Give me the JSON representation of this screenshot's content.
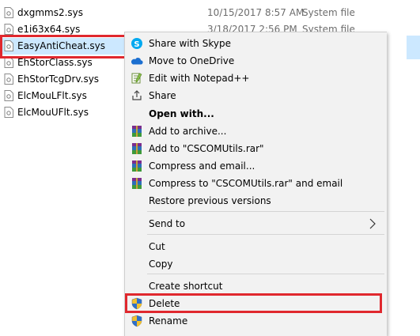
{
  "files": [
    {
      "name": "dxgmms2.sys",
      "date": "10/15/2017 8:57 AM",
      "type": "System file"
    },
    {
      "name": "e1i63x64.sys",
      "date": "3/18/2017 2:56 PM",
      "type": "System file"
    },
    {
      "name": "EasyAntiCheat.sys",
      "date": "",
      "type": ""
    },
    {
      "name": "EhStorClass.sys",
      "date": "",
      "type": ""
    },
    {
      "name": "EhStorTcgDrv.sys",
      "date": "",
      "type": ""
    },
    {
      "name": "ElcMouLFlt.sys",
      "date": "",
      "type": ""
    },
    {
      "name": "ElcMouUFlt.sys",
      "date": "",
      "type": ""
    }
  ],
  "menu": {
    "share_skype": "Share with Skype",
    "move_onedrive": "Move to OneDrive",
    "edit_notepad": "Edit with Notepad++",
    "share": "Share",
    "open_with": "Open with...",
    "add_archive": "Add to archive...",
    "add_rar": "Add to \"CSCOMUtils.rar\"",
    "compress_email": "Compress and email...",
    "compress_rar_email": "Compress to \"CSCOMUtils.rar\" and email",
    "restore": "Restore previous versions",
    "send_to": "Send to",
    "cut": "Cut",
    "copy": "Copy",
    "create_shortcut": "Create shortcut",
    "delete": "Delete",
    "rename": "Rename"
  },
  "colors": {
    "highlight": "#e0282e",
    "selection": "#cce8ff",
    "menu_bg": "#f2f2f2"
  }
}
